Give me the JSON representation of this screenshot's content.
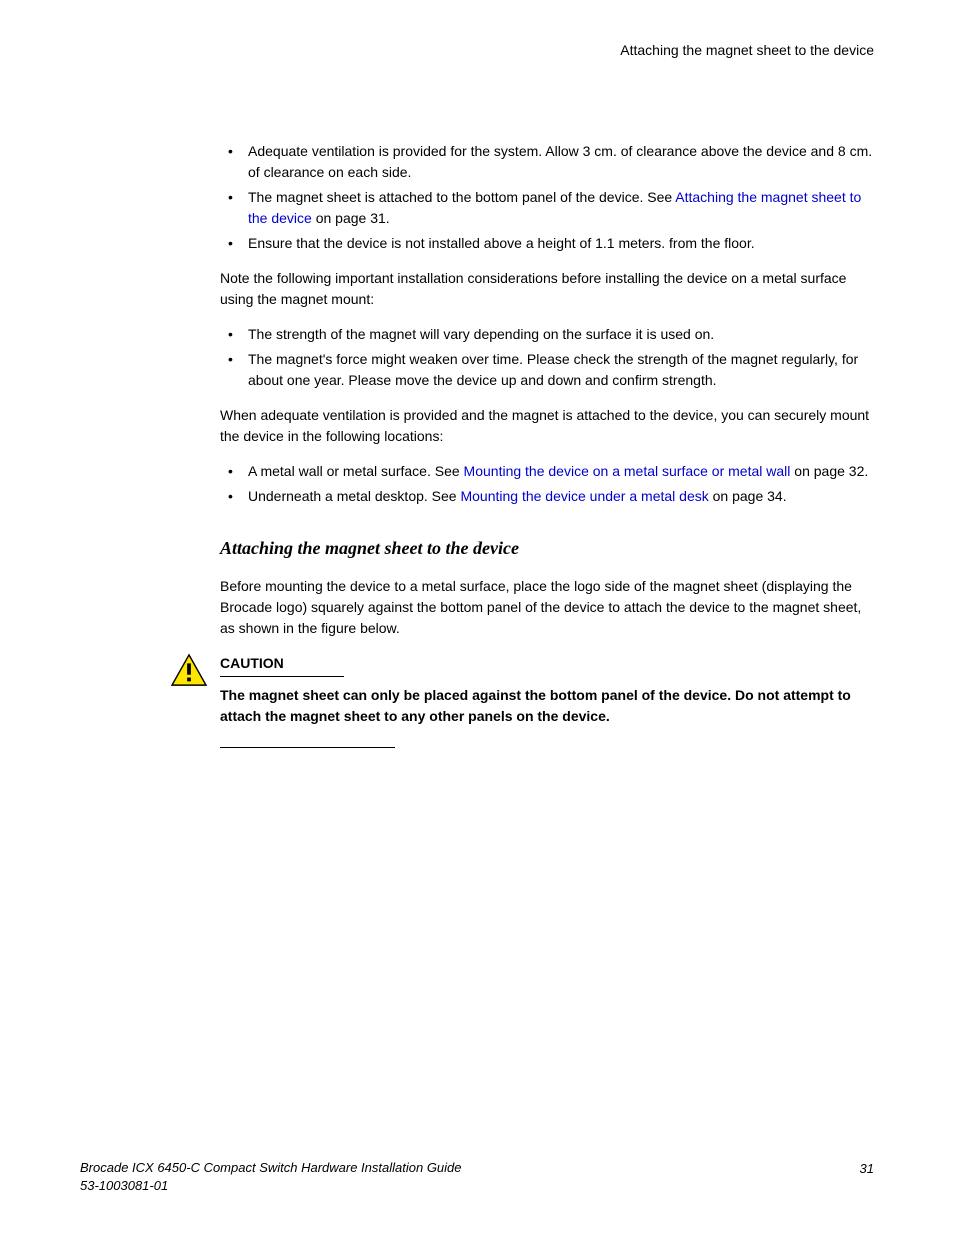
{
  "header": {
    "title": "Attaching the magnet sheet to the device"
  },
  "list1": {
    "item1": "Adequate ventilation is provided for the system. Allow 3 cm. of clearance above the device and 8 cm. of clearance on each side.",
    "item2_pre": "The magnet sheet is attached to the bottom panel of the device. See ",
    "item2_link": "Attaching the magnet sheet to the device",
    "item2_post": " on page 31.",
    "item3": "Ensure that the device is not installed above a height of 1.1 meters. from the floor."
  },
  "para1": "Note the following important installation considerations before installing the device on a metal surface using the magnet mount:",
  "list2": {
    "item1": "The strength of the magnet will vary depending on the surface it is used on.",
    "item2": "The magnet's force might weaken over time. Please check the strength of the magnet regularly, for about one year. Please move the device up and down and confirm strength."
  },
  "para2": "When adequate ventilation is provided and the magnet is attached to the device, you can securely mount the device in the following locations:",
  "list3": {
    "item1_pre": "A metal wall or metal surface. See ",
    "item1_link": "Mounting the device on a metal surface or metal wall",
    "item1_post": " on page 32.",
    "item2_pre": "Underneath a metal desktop. See ",
    "item2_link": "Mounting the device under a metal desk",
    "item2_post": " on page 34."
  },
  "section": {
    "heading": "Attaching the magnet sheet to the device",
    "para": "Before mounting the device to a metal surface, place the logo side of the magnet sheet (displaying the Brocade logo) squarely against the bottom panel of the device to attach the device to the magnet sheet, as shown in the figure below."
  },
  "caution": {
    "label": "CAUTION",
    "text": "The magnet sheet can only be placed against the bottom panel of the device. Do not attempt to attach the magnet sheet to any other panels on the device."
  },
  "footer": {
    "title": "Brocade ICX 6450-C Compact Switch Hardware Installation Guide",
    "docnum": "53-1003081-01",
    "page": "31"
  }
}
